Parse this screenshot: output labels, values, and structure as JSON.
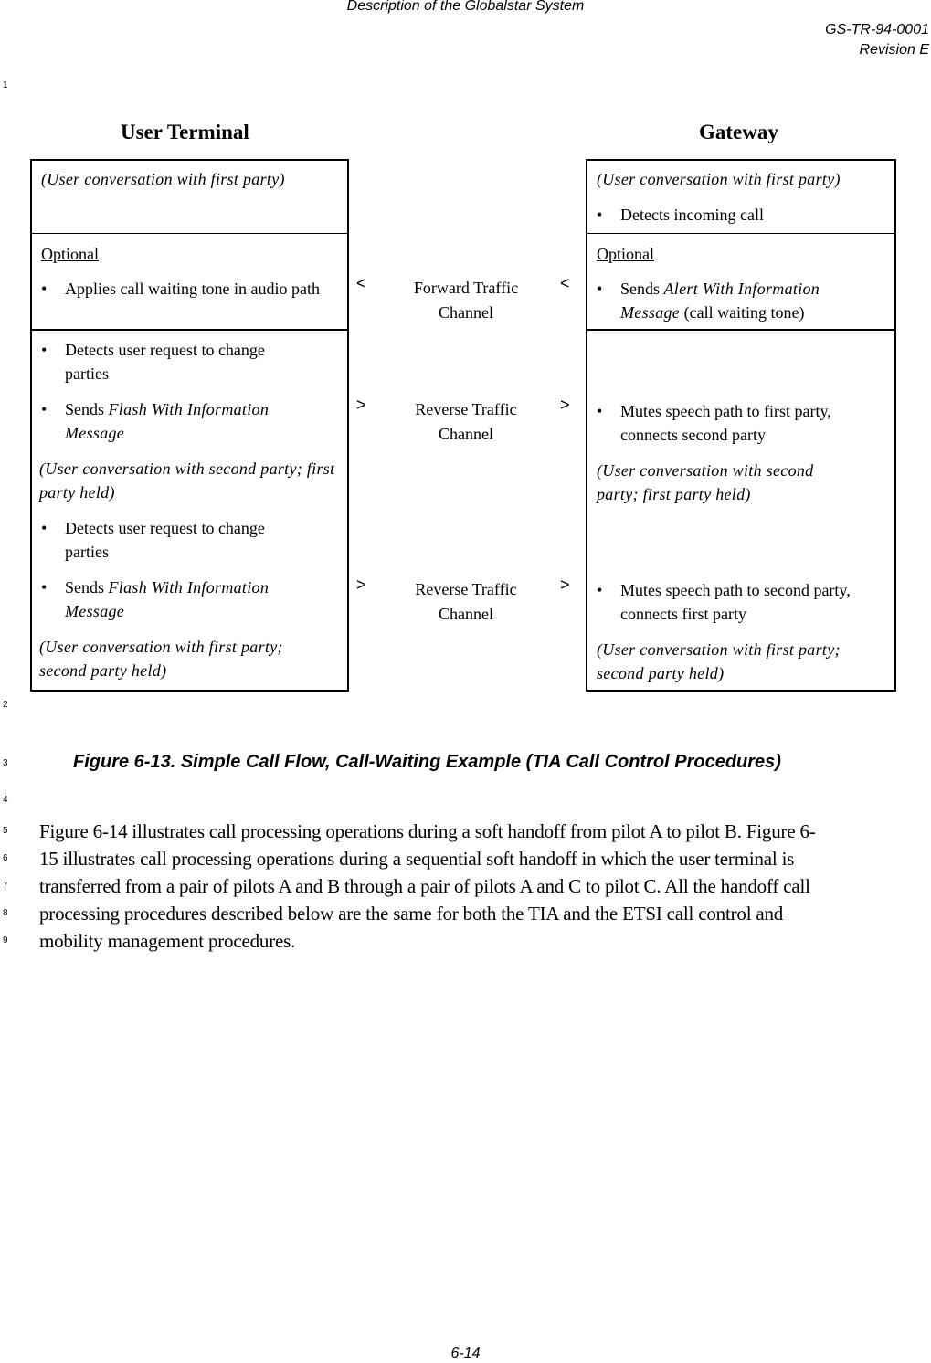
{
  "header": {
    "title": "Description of the Globalstar System",
    "doc_id": "GS-TR-94-0001",
    "revision": "Revision E"
  },
  "line_numbers": [
    "1",
    "2",
    "3",
    "4",
    "5",
    "6",
    "7",
    "8",
    "9"
  ],
  "figure": {
    "left_title": "User Terminal",
    "right_title": "Gateway",
    "left": {
      "row1": {
        "italic": "(User conversation with first party)"
      },
      "row2": {
        "optional": "Optional",
        "bullet": "Applies call waiting tone in audio path"
      },
      "row3": {
        "bullet1": "Detects user request to change parties",
        "bullet2_prefix": "Sends ",
        "bullet2_italic": "Flash With Information Message",
        "italic": "(User conversation with second party; first party held)",
        "bullet3": "Detects user request to change parties",
        "bullet4_prefix": "Sends ",
        "bullet4_italic": "Flash With Information Message",
        "italic2": "(User conversation with first party; second party held)"
      }
    },
    "right": {
      "row1": {
        "italic": "(User conversation with first party)",
        "bullet": "Detects incoming call"
      },
      "row2": {
        "optional": "Optional",
        "bullet_prefix": "Sends ",
        "bullet_italic": "Alert With Information Message",
        "bullet_suffix": " (call waiting tone)"
      },
      "row3": {
        "bullet1": "Mutes speech path to first party, connects second party",
        "italic1": "(User conversation with second party; first party held)",
        "bullet2": "Mutes speech path to second party, connects first party",
        "italic2": "(User conversation with first party; second party held)"
      }
    },
    "messages": [
      {
        "direction": "<",
        "channel_line1": "Forward Traffic",
        "channel_line2": "Channel"
      },
      {
        "direction": ">",
        "channel_line1": "Reverse Traffic",
        "channel_line2": "Channel"
      },
      {
        "direction": ">",
        "channel_line1": "Reverse Traffic",
        "channel_line2": "Channel"
      }
    ],
    "bullet_glyph": "•",
    "caption": "Figure 6-13.  Simple Call Flow, Call-Waiting Example (TIA Call Control Procedures)"
  },
  "paragraph": [
    "Figure 6-14 illustrates call processing operations during a soft handoff from pilot A to pilot B. Figure 6-",
    "15 illustrates call processing operations during a sequential soft handoff in which the user terminal is",
    "transferred from a pair of pilots A and B through a pair of pilots A and C to pilot C. All the handoff call",
    "processing procedures described below are the same for both the TIA and the ETSI call control and",
    "mobility management procedures."
  ],
  "footer": {
    "page": "6-14"
  }
}
